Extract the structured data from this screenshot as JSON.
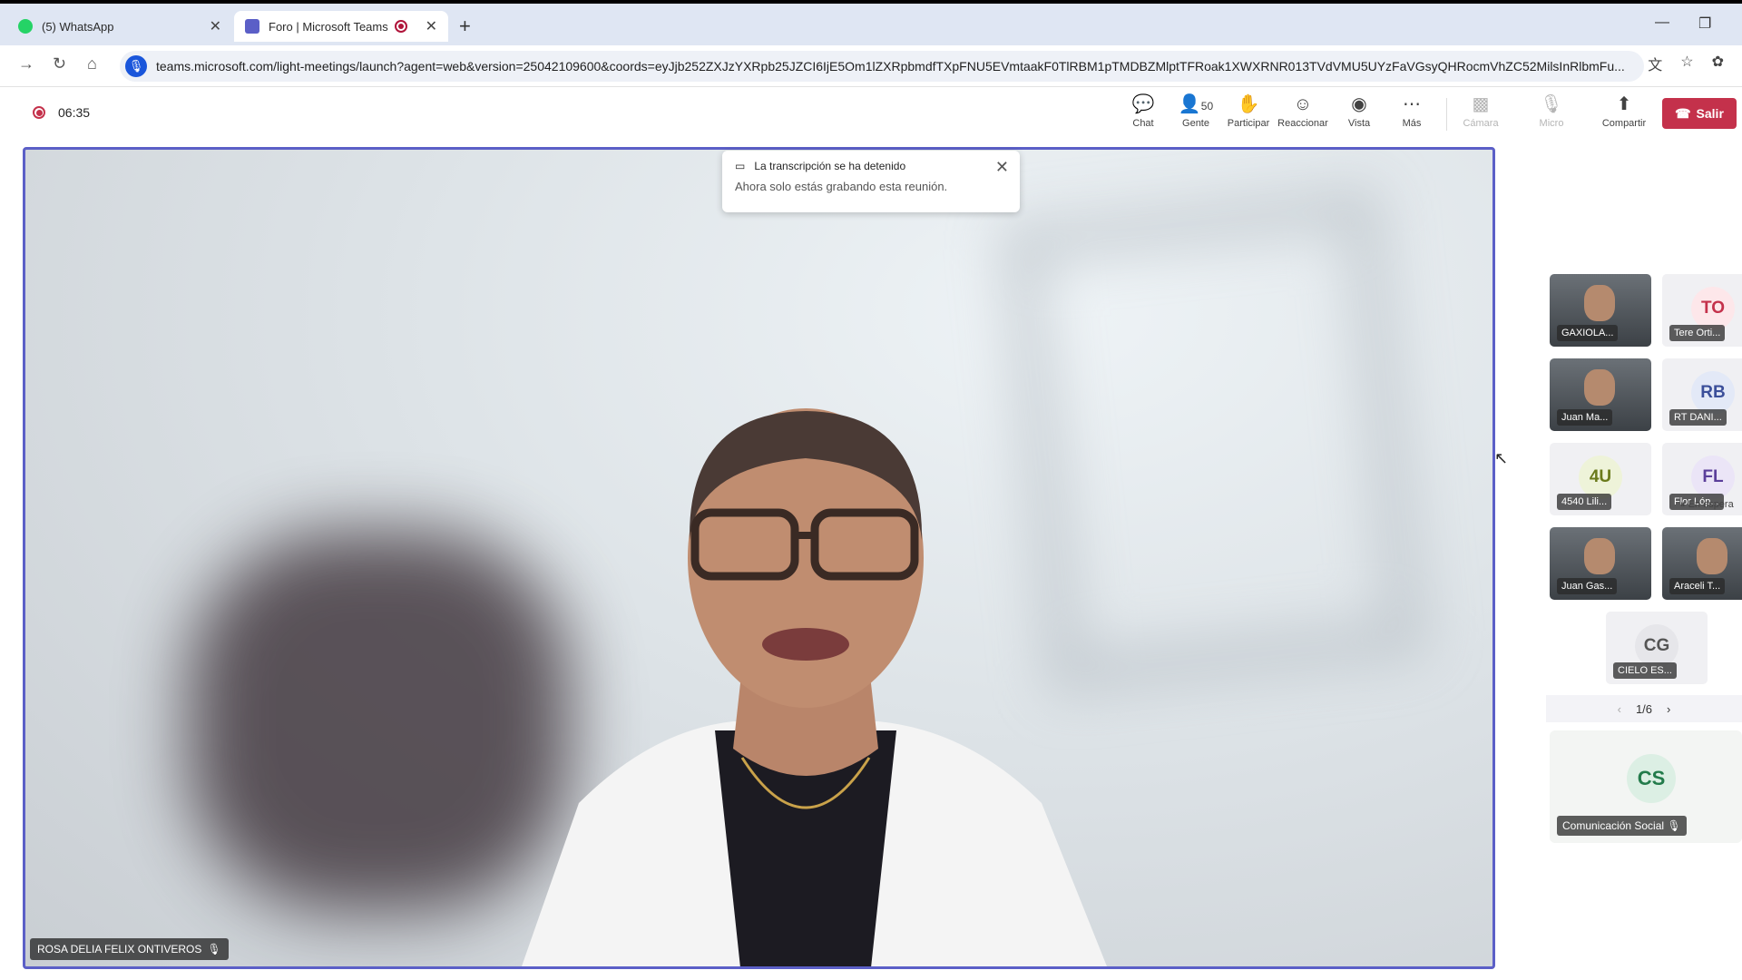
{
  "browser": {
    "tabs": [
      {
        "label": "(5) WhatsApp",
        "active": false,
        "icon": "whatsapp-icon"
      },
      {
        "label": "Foro | Microsoft Teams",
        "active": true,
        "icon": "teams-icon"
      }
    ],
    "url": "teams.microsoft.com/light-meetings/launch?agent=web&version=25042109600&coords=eyJjb252ZXJzYXRpb25JZCI6IjE5Om1lZXRpbmdfTXpFNU5EVmtaakF0TlRBM1pTMDBZMlptTFRoak1XWXRNR013TVdVMU5UYzFaVGsyQHRocmVhZC52MilsInRlbmFu...",
    "colors": {
      "accent": "#5b5fc7",
      "leave": "#c4314b"
    }
  },
  "toolbar": {
    "timer": "06:35",
    "people_count": "50",
    "buttons": [
      {
        "label": "Chat",
        "icon": "chat-icon"
      },
      {
        "label": "Gente",
        "icon": "people-icon"
      },
      {
        "label": "Participar",
        "icon": "raise-hand-icon"
      },
      {
        "label": "Reaccionar",
        "icon": "smile-icon"
      },
      {
        "label": "Vista",
        "icon": "view-icon"
      },
      {
        "label": "Más",
        "icon": "more-icon"
      },
      {
        "label": "Cámara",
        "icon": "camera-off-icon"
      },
      {
        "label": "Micro",
        "icon": "mic-off-icon"
      },
      {
        "label": "Compartir",
        "icon": "share-icon"
      }
    ],
    "leave_label": "Salir"
  },
  "toast": {
    "title": "La transcripción se ha detenido",
    "message": "Ahora solo estás grabando esta reunión."
  },
  "stage": {
    "speaker_name": "ROSA DELIA FELIX ONTIVEROS"
  },
  "gallery": {
    "tiles": [
      {
        "name": "GAXIOLA...",
        "initials": "",
        "photo": true
      },
      {
        "name": "Tere Orti...",
        "initials": "TO",
        "photo": false,
        "bg": "#fde7ea",
        "fg": "#c4314b"
      },
      {
        "name": "Juan Ma...",
        "initials": "",
        "photo": true
      },
      {
        "name": "RT DANI...",
        "initials": "RB",
        "photo": false,
        "bg": "#e3e9f7",
        "fg": "#3b4f9a"
      },
      {
        "name": "4540 Lili...",
        "initials": "4U",
        "photo": false,
        "bg": "#eef3d9",
        "fg": "#6a7a1b"
      },
      {
        "name": "Flor Lóp...",
        "initials": "FL",
        "photo": false,
        "bg": "#ebe5f7",
        "fg": "#5b3f9a"
      },
      {
        "name": "Juan Gas...",
        "initials": "",
        "photo": true
      },
      {
        "name": "Araceli T...",
        "initials": "",
        "photo": true
      },
      {
        "name": "CIELO ES...",
        "initials": "CG",
        "photo": false,
        "bg": "#e6e6ea",
        "fg": "#555"
      }
    ],
    "waiting_label": "En espera",
    "page": "1/6",
    "featured": {
      "name": "Comunicación Social",
      "initials": "CS"
    }
  }
}
